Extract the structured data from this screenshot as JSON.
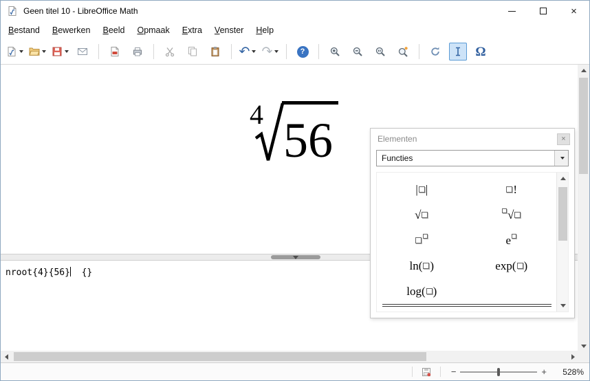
{
  "window": {
    "title": "Geen titel 10 - LibreOffice Math"
  },
  "menu_bar": {
    "items": [
      {
        "name": "bestand",
        "label": "Bestand"
      },
      {
        "name": "bewerken",
        "label": "Bewerken"
      },
      {
        "name": "beeld",
        "label": "Beeld"
      },
      {
        "name": "opmaak",
        "label": "Opmaak"
      },
      {
        "name": "extra",
        "label": "Extra"
      },
      {
        "name": "venster",
        "label": "Venster"
      },
      {
        "name": "help",
        "label": "Help"
      }
    ]
  },
  "icons": {
    "omega": "Ω",
    "help": "?",
    "undo": "↶",
    "redo": "↷",
    "close": "×",
    "panel_close": "×",
    "zoom_minus": "−",
    "zoom_plus": "+"
  },
  "formula_view": {
    "root_index": "4",
    "radicand": "56"
  },
  "elements_panel": {
    "title": "Elementen",
    "category_selected": "Functies",
    "items": [
      {
        "name": "absolute-value",
        "parts": [
          "|",
          "ph",
          "|"
        ]
      },
      {
        "name": "factorial",
        "parts": [
          "ph",
          "!"
        ]
      },
      {
        "name": "square-root",
        "parts": [
          "√",
          "ph"
        ]
      },
      {
        "name": "nth-root",
        "parts": [
          "sup-ph",
          "√",
          "ph"
        ]
      },
      {
        "name": "power",
        "parts": [
          "ph",
          "sup-ph"
        ]
      },
      {
        "name": "e-power",
        "parts": [
          "e",
          "sup-ph"
        ]
      },
      {
        "name": "natural-logarithm",
        "parts": [
          "ln(",
          "ph",
          ")"
        ]
      },
      {
        "name": "exp-function",
        "parts": [
          "exp(",
          "ph",
          ")"
        ]
      },
      {
        "name": "logarithm",
        "parts": [
          "log(",
          "ph",
          ")"
        ]
      }
    ]
  },
  "command_editor": {
    "text_before_cursor": "nroot{4}{56}",
    "text_after_cursor": "  {}"
  },
  "status_bar": {
    "zoom_level": "528%"
  },
  "colors": {
    "accent_blue": "#3465a4",
    "active_toggle_bg": "#cde3f8",
    "active_toggle_border": "#5b9bd5"
  }
}
